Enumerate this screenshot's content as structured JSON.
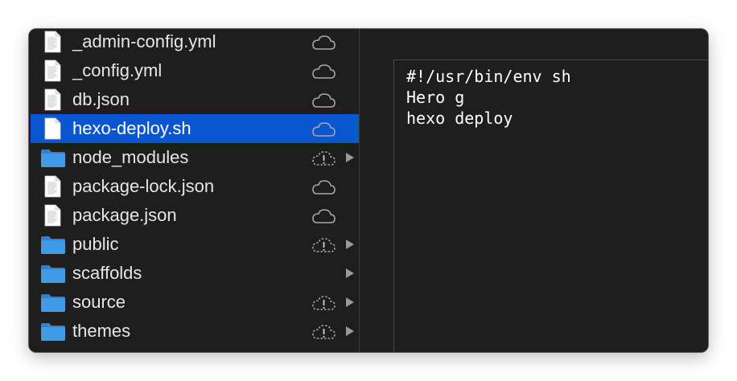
{
  "files": [
    {
      "name": "_admin-config.yml",
      "kind": "file",
      "cloud": "cloud-icon",
      "expandable": false,
      "selected": false
    },
    {
      "name": "_config.yml",
      "kind": "file",
      "cloud": "cloud-icon",
      "expandable": false,
      "selected": false
    },
    {
      "name": "db.json",
      "kind": "file",
      "cloud": "cloud-icon",
      "expandable": false,
      "selected": false
    },
    {
      "name": "hexo-deploy.sh",
      "kind": "file",
      "cloud": "cloud-icon",
      "expandable": false,
      "selected": true
    },
    {
      "name": "node_modules",
      "kind": "folder",
      "cloud": "cloud-warning-icon",
      "expandable": true,
      "selected": false
    },
    {
      "name": "package-lock.json",
      "kind": "file",
      "cloud": "cloud-icon",
      "expandable": false,
      "selected": false
    },
    {
      "name": "package.json",
      "kind": "file",
      "cloud": "cloud-icon",
      "expandable": false,
      "selected": false
    },
    {
      "name": "public",
      "kind": "folder",
      "cloud": "cloud-warning-icon",
      "expandable": true,
      "selected": false
    },
    {
      "name": "scaffolds",
      "kind": "folder",
      "cloud": "",
      "expandable": true,
      "selected": false
    },
    {
      "name": "source",
      "kind": "folder",
      "cloud": "cloud-warning-icon",
      "expandable": true,
      "selected": false
    },
    {
      "name": "themes",
      "kind": "folder",
      "cloud": "cloud-warning-icon",
      "expandable": true,
      "selected": false
    }
  ],
  "preview": {
    "lines": [
      "#!/usr/bin/env sh",
      "Hero g",
      "hexo deploy"
    ]
  },
  "colors": {
    "background": "#1e1e1f",
    "selection": "#0a56d1",
    "folder": "#3f9ae8",
    "text": "#e6e6e6"
  }
}
